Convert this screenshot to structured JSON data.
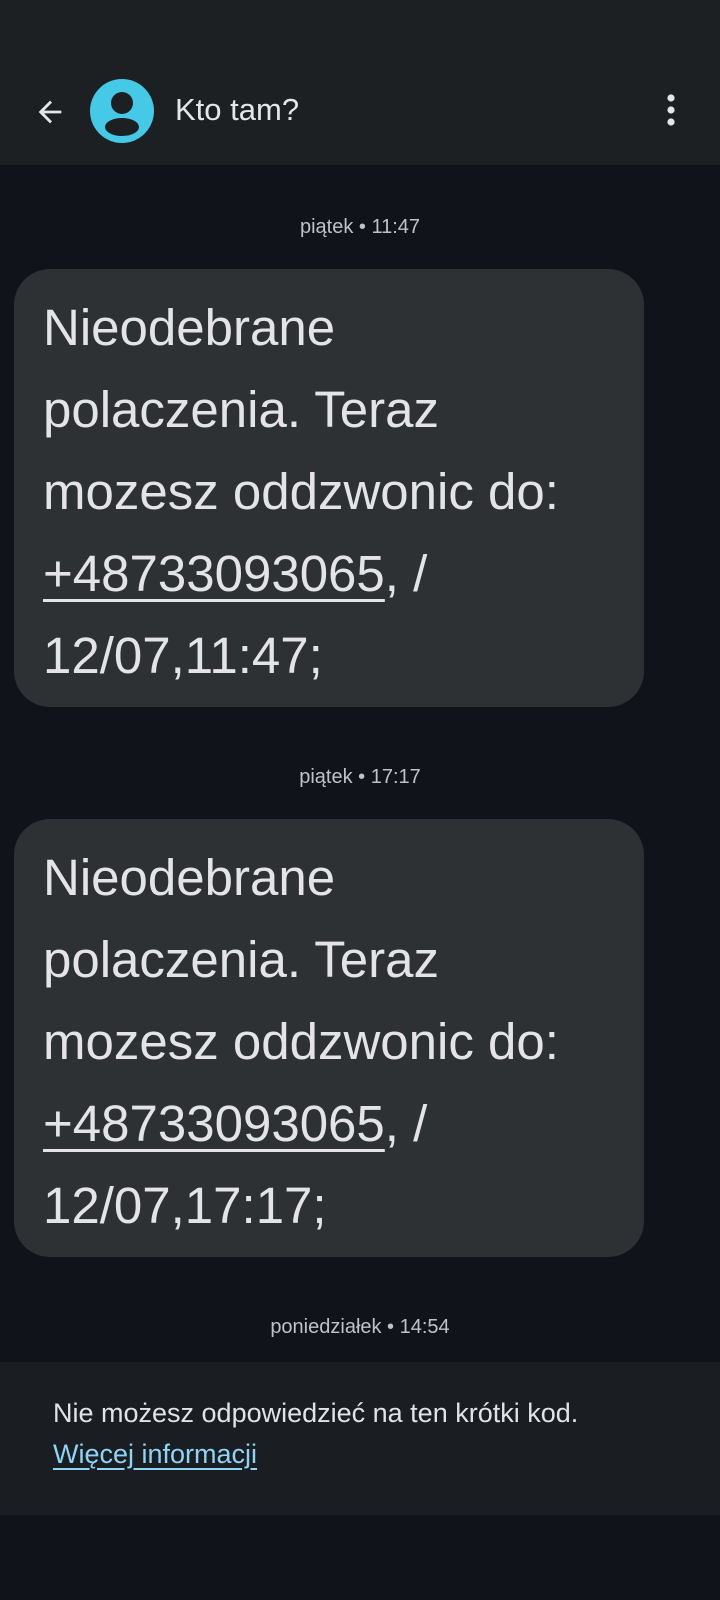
{
  "header": {
    "contact_name": "Kto tam?",
    "back_icon": "arrow-back-icon",
    "more_icon": "more-vert-icon",
    "avatar_color": "#46c9e6"
  },
  "messages": [
    {
      "timestamp": "piątek • 11:47",
      "line1": "Nieodebrane",
      "line2": "polaczenia. Teraz",
      "line3": "mozesz oddzwonic do:",
      "phone": "+48733093065",
      "after_phone": ", /",
      "line5": "12/07,11:47;"
    },
    {
      "timestamp": "piątek • 17:17",
      "line1": "Nieodebrane",
      "line2": "polaczenia. Teraz",
      "line3": "mozesz oddzwonic do:",
      "phone": "+48733093065",
      "after_phone": ", /",
      "line5": "12/07,17:17;"
    }
  ],
  "last_timestamp": "poniedziałek • 14:54",
  "footer": {
    "notice": "Nie możesz odpowiedzieć na ten krótki kod.",
    "link": "Więcej informacji",
    "link_color": "#8fd3f5"
  }
}
